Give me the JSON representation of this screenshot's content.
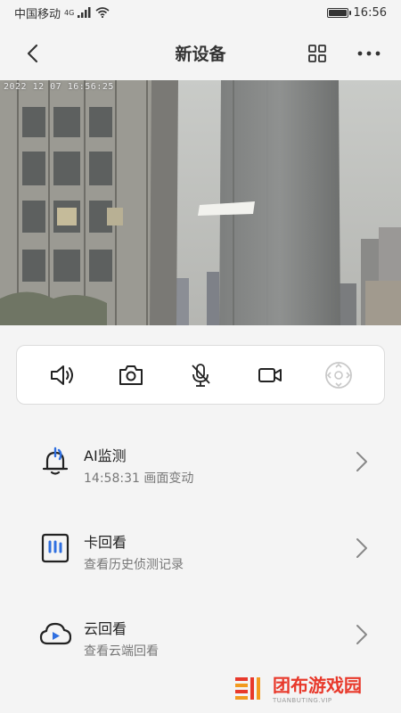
{
  "status_bar": {
    "carrier": "中国移动",
    "network": "4G",
    "time": "16:56",
    "battery_level": 1.0
  },
  "header": {
    "title": "新设备"
  },
  "camera": {
    "timestamp": "2022 12 07 16:56:25"
  },
  "controls": {
    "items": [
      "speaker-icon",
      "camera-icon",
      "microphone-muted-icon",
      "video-record-icon",
      "ptz-control-icon"
    ]
  },
  "menu": {
    "items": [
      {
        "title": "AI监测",
        "subtitle": "14:58:31 画面变动",
        "icon": "bell-icon"
      },
      {
        "title": "卡回看",
        "subtitle": "查看历史侦测记录",
        "icon": "sd-card-icon"
      },
      {
        "title": "云回看",
        "subtitle": "查看云端回看",
        "icon": "cloud-play-icon"
      }
    ]
  },
  "watermark": {
    "name": "团布游戏园",
    "url": "TUANBUTING.VIP"
  },
  "colors": {
    "accent_blue": "#2f6fe0",
    "watermark_red": "#e8392b",
    "watermark_orange": "#f29a1f"
  }
}
